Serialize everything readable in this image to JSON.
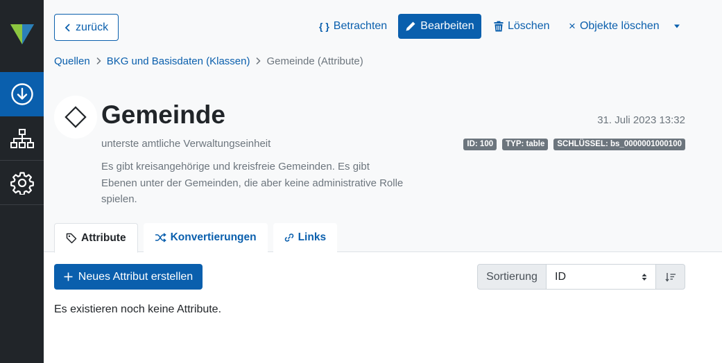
{
  "toolbar": {
    "back_label": "zurück",
    "view_icon": "{ }",
    "view_label": "Betrachten",
    "edit_label": "Bearbeiten",
    "delete_label": "Löschen",
    "delete_objects_icon": "×",
    "delete_objects_label": "Objekte löschen"
  },
  "breadcrumb": {
    "items": [
      "Quellen",
      "BKG und Basisdaten (Klassen)",
      "Gemeinde (Attribute)"
    ]
  },
  "object": {
    "title": "Gemeinde",
    "subtitle": "unterste amtliche Verwaltungseinheit",
    "description": "Es gibt kreisangehörige und kreisfreie Gemeinden. Es gibt Ebenen unter der Gemeinden, die aber keine administrative Rolle spielen.",
    "date": "31. Juli 2023 13:32",
    "badges": [
      "ID: 100",
      "TYP: table",
      "SCHLÜSSEL: bs_0000001000100"
    ]
  },
  "tabs": [
    {
      "label": "Attribute",
      "icon": "tag-icon",
      "active": true
    },
    {
      "label": "Konvertierungen",
      "icon": "shuffle-icon",
      "active": false
    },
    {
      "label": "Links",
      "icon": "link-icon",
      "active": false
    }
  ],
  "actions": {
    "new_attribute_label": "Neues Attribut erstellen"
  },
  "sort": {
    "label": "Sortierung",
    "value": "ID"
  },
  "empty_message": "Es existieren noch keine Attribute.",
  "colors": {
    "accent": "#0a5fad",
    "sidebar": "#212529",
    "sidebar_active": "#0a5fad",
    "badge": "#6c757d"
  }
}
